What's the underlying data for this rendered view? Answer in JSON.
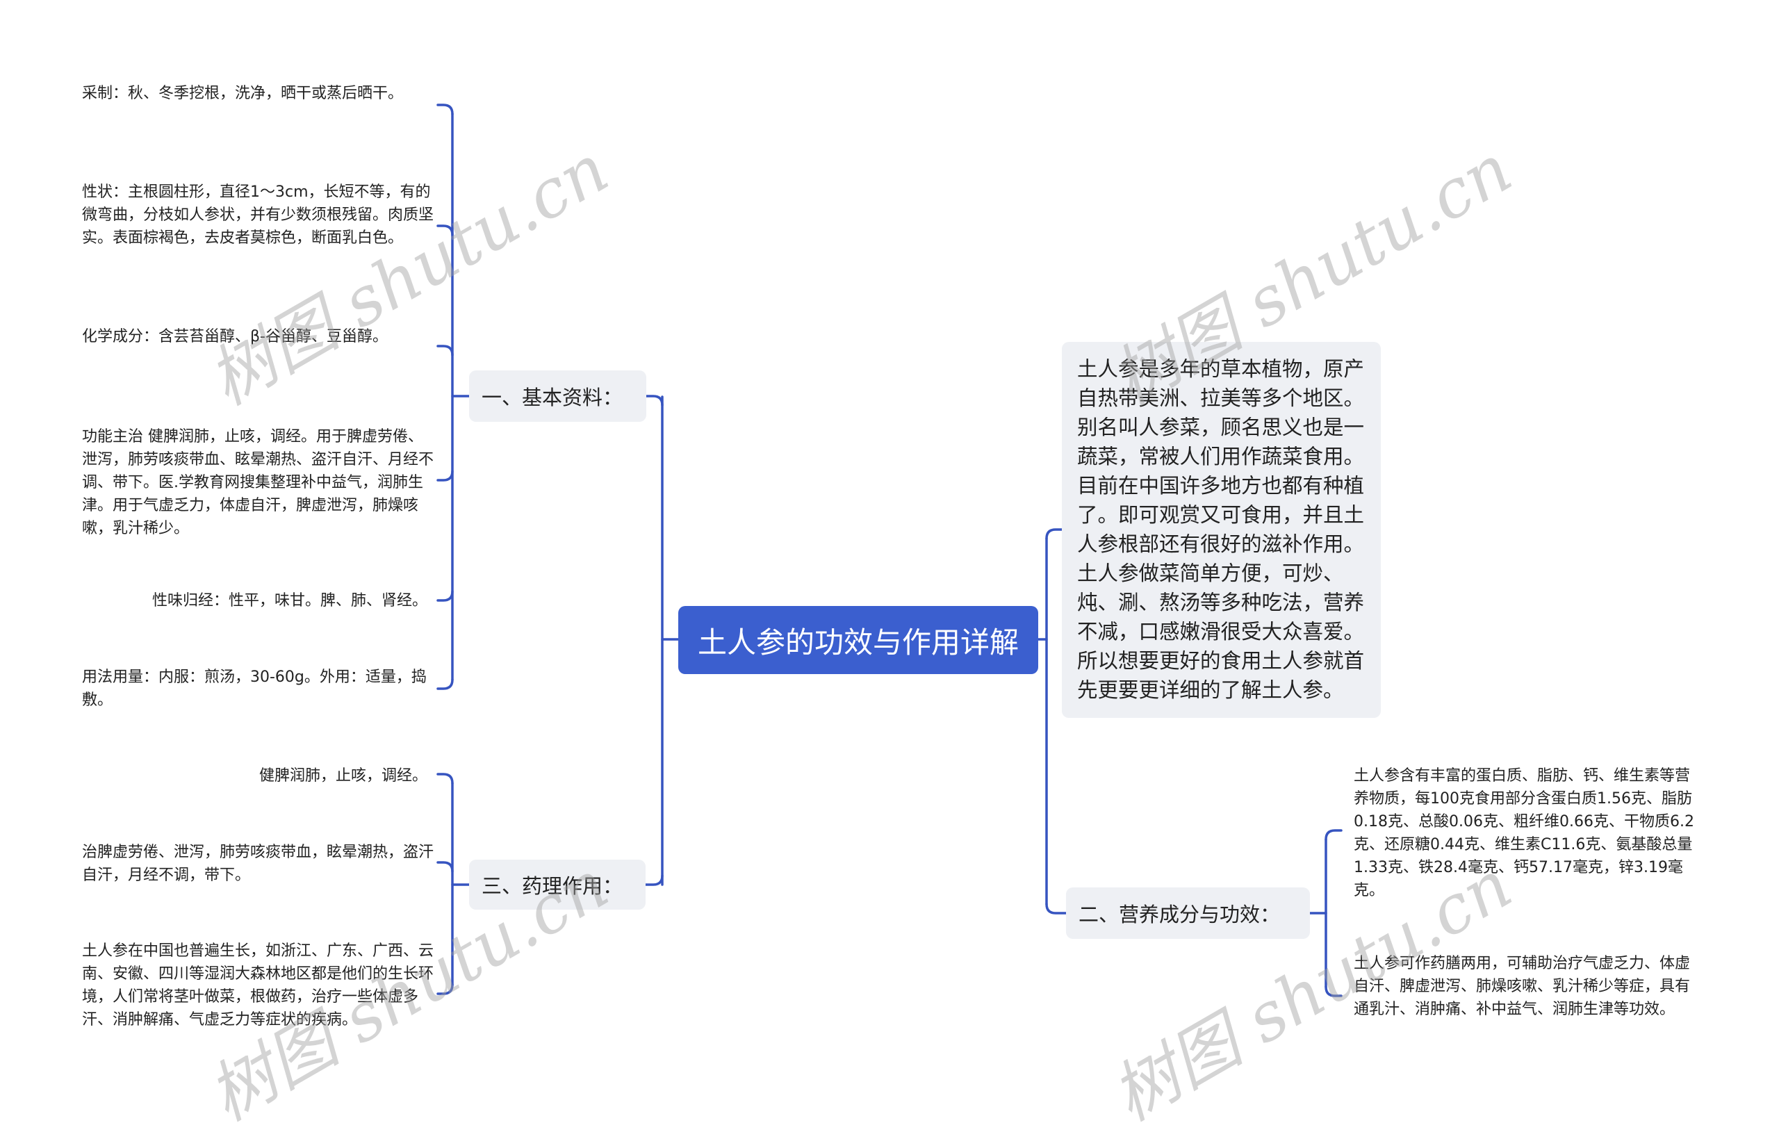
{
  "root": {
    "title": "土人参的功效与作用详解"
  },
  "colors": {
    "accent": "#3b5fcf",
    "branch_bg": "#eef0f4",
    "line": "#3654c0",
    "text": "#222222"
  },
  "intro": {
    "text": "土人参是多年的草本植物，原产自热带美洲、拉美等多个地区。别名叫人参菜，顾名思义也是一蔬菜，常被人们用作蔬菜食用。目前在中国许多地方也都有种植了。即可观赏又可食用，并且土人参根部还有很好的滋补作用。土人参做菜简单方便，可炒、炖、涮、熬汤等多种吃法，营养不减，口感嫩滑很受大众喜爱。所以想要更好的食用土人参就首先更要更详细的了解土人参。"
  },
  "branches": [
    {
      "label": "一、基本资料：",
      "leaves": [
        "采制：秋、冬季挖根，洗净，晒干或蒸后晒干。",
        "性状：主根圆柱形，直径1～3cm，长短不等，有的微弯曲，分枝如人参状，并有少数须根残留。肉质坚实。表面棕褐色，去皮者莫棕色，断面乳白色。",
        "化学成分：含芸苔甾醇、β-谷甾醇、豆甾醇。",
        "功能主治 健脾润肺，止咳，调经。用于脾虚劳倦、泄泻，肺劳咳痰带血、眩晕潮热、盗汗自汗、月经不调、带下。医.学教育网搜集整理补中益气，润肺生津。用于气虚乏力，体虚自汗，脾虚泄泻，肺燥咳嗽，乳汁稀少。",
        "性味归经：性平，味甘。脾、肺、肾经。",
        "用法用量：内服：煎汤，30-60g。外用：适量，捣敷。"
      ]
    },
    {
      "label": "二、营养成分与功效：",
      "leaves": [
        "土人参含有丰富的蛋白质、脂肪、钙、维生素等营养物质，每100克食用部分含蛋白质1.56克、脂肪0.18克、总酸0.06克、粗纤维0.66克、干物质6.2克、还原糖0.44克、维生素C11.6克、氨基酸总量1.33克、铁28.4毫克、钙57.17毫克，锌3.19毫克。",
        "土人参可作药膳两用，可辅助治疗气虚乏力、体虚自汗、脾虚泄泻、肺燥咳嗽、乳汁稀少等症，具有通乳汁、消肿痛、补中益气、润肺生津等功效。"
      ]
    },
    {
      "label": "三、药理作用：",
      "leaves": [
        "健脾润肺，止咳，调经。",
        "治脾虚劳倦、泄泻，肺劳咳痰带血，眩晕潮热，盗汗自汗，月经不调，带下。",
        "土人参在中国也普遍生长，如浙江、广东、广西、云南、安徽、四川等湿润大森林地区都是他们的生长环境，人们常将茎叶做菜，根做药，治疗一些体虚多汗、消肿解痛、气虚乏力等症状的疾病。"
      ]
    }
  ],
  "watermark": {
    "text": "树图 shutu.cn"
  }
}
